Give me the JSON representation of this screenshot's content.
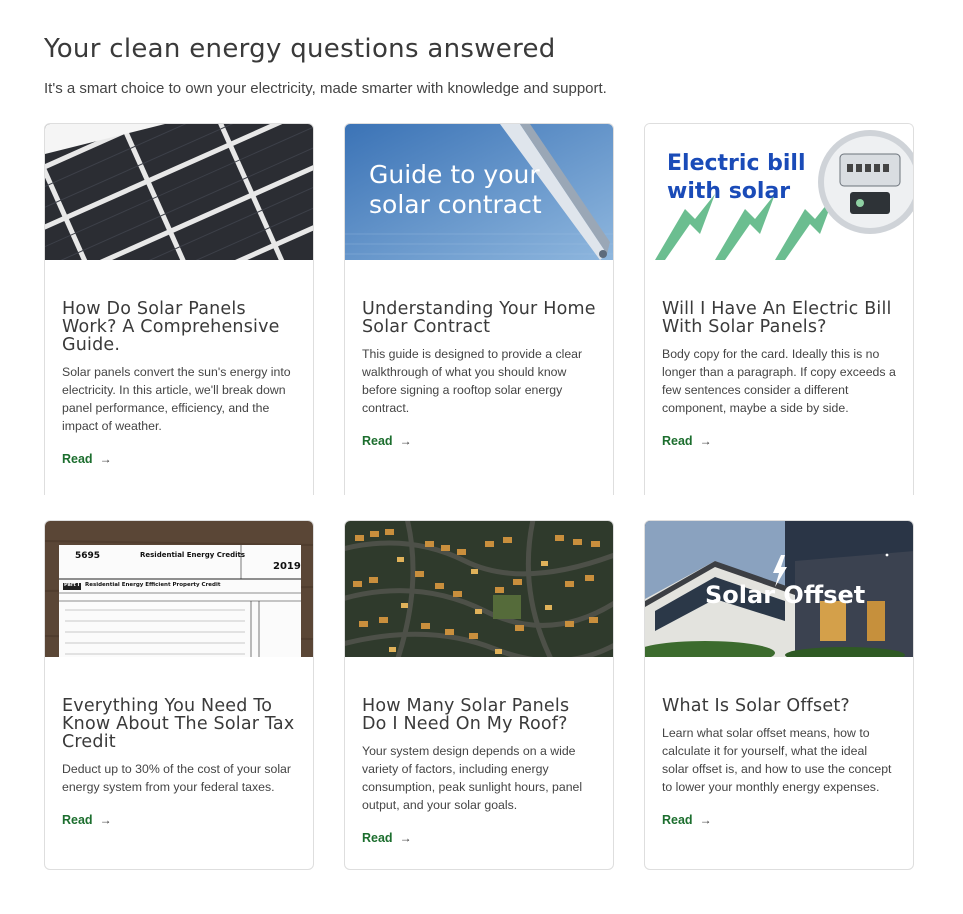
{
  "header": {
    "title": "Your clean energy questions answered",
    "subtitle": "It's a smart choice to own your electricity, made smarter with knowledge and support."
  },
  "cards": [
    {
      "image": "solar-panel-closeup-image",
      "title": "How Do Solar Panels Work? A Comprehensive Guide.",
      "text": "Solar panels convert the sun's energy into electricity. In this article, we'll break down panel performance, efficiency, and the impact of weather.",
      "link": "Read"
    },
    {
      "image": "contract-pen-image",
      "image_text": [
        "Guide to your",
        "solar contract"
      ],
      "title": "Understanding Your Home Solar Contract",
      "text": "This guide is designed to provide a clear walkthrough of what you should know before signing a rooftop solar energy contract.",
      "link": "Read"
    },
    {
      "image": "electric-meter-image",
      "image_text": [
        "Electric bill",
        "with solar"
      ],
      "title": "Will I Have An Electric Bill With Solar Panels?",
      "text": "Body copy for the card. Ideally this is no longer than a paragraph. If copy exceeds a few sentences consider a different component, maybe a side by side.",
      "link": "Read"
    },
    {
      "image": "tax-form-image",
      "image_text": {
        "form_number": "5695",
        "form_title": "Residential Energy Credits",
        "year": "2019",
        "part": "Part I",
        "part_title": "Residential Energy Efficient Property Credit"
      },
      "title": "Everything You Need To Know About The Solar Tax Credit",
      "text": "Deduct up to 30% of the cost of your solar energy system from your federal taxes.",
      "link": "Read"
    },
    {
      "image": "aerial-neighborhood-image",
      "title": "How Many Solar Panels Do I Need On My Roof?",
      "text": "Your system design depends on a wide variety of factors, including energy consumption, peak sunlight hours, panel output, and your solar goals.",
      "link": "Read"
    },
    {
      "image": "solar-offset-house-image",
      "image_text": [
        "Solar Offset"
      ],
      "title": "What Is Solar Offset?",
      "text": "Learn what solar offset means, how to calculate it for yourself, what the ideal solar offset is, and how to use the concept to lower your monthly energy expenses.",
      "link": "Read"
    }
  ],
  "colors": {
    "link": "#1c6e2e",
    "title": "#3a3a3a",
    "border": "#dedede"
  }
}
